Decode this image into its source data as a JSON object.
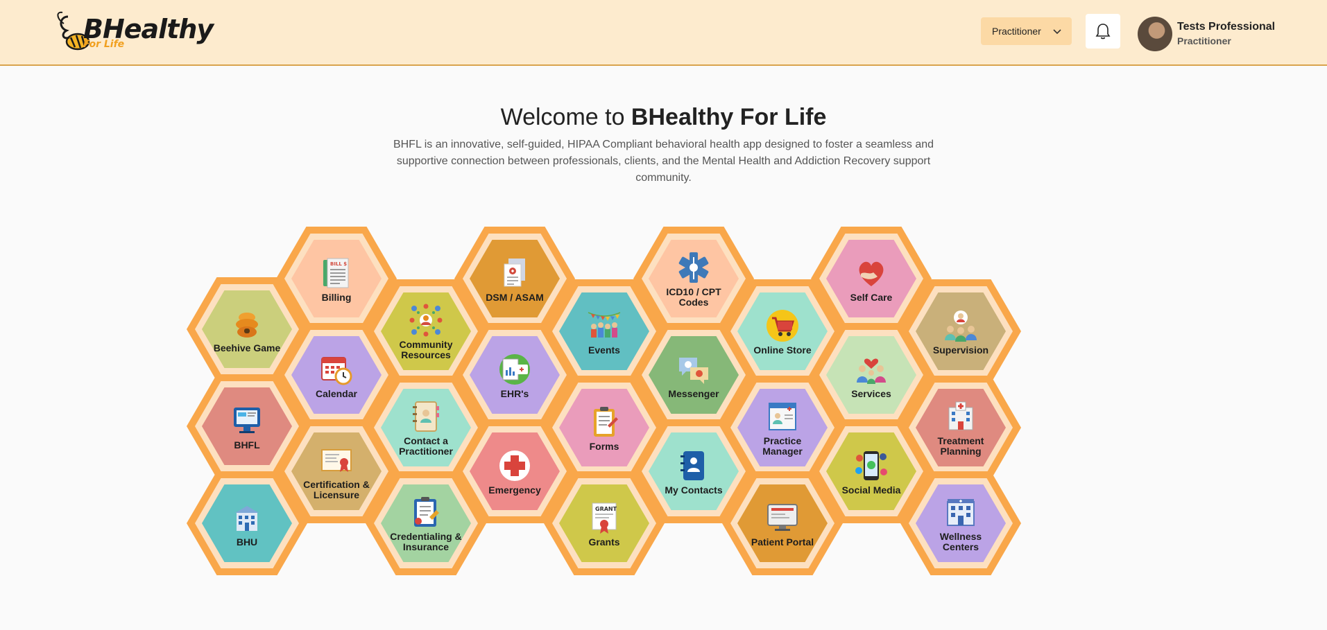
{
  "brand": {
    "main": "BHealthy",
    "sub": "For Life"
  },
  "header": {
    "role_selected": "Practitioner",
    "user_name": "Tests Professional",
    "user_role": "Practitioner"
  },
  "welcome": {
    "prefix": "Welcome to ",
    "name": "BHealthy For Life",
    "intro": "BHFL is an innovative, self-guided, HIPAA Compliant behavioral health app designed to foster a seamless and supportive connection between professionals, clients, and the Mental Health and Addiction Recovery support community."
  },
  "tiles": [
    {
      "label": "Beehive Game",
      "color": "#cbcf7c",
      "icon": "beehive-icon"
    },
    {
      "label": "BHFL",
      "color": "#df8a80",
      "icon": "computer-icon"
    },
    {
      "label": "BHU",
      "color": "#61c2c2",
      "icon": "building-icon"
    },
    {
      "label": "Billing",
      "color": "#fec5a3",
      "icon": "bill-icon"
    },
    {
      "label": "Calendar",
      "color": "#bba3e6",
      "icon": "calendar-icon"
    },
    {
      "label": "Certification & Licensure",
      "color": "#d4b06c",
      "icon": "certificate-icon"
    },
    {
      "label": "Community Resources",
      "color": "#cfc84a",
      "icon": "community-icon"
    },
    {
      "label": "Contact a Practitioner",
      "color": "#9ee1cd",
      "icon": "contact-book-icon"
    },
    {
      "label": "Credentialing & Insurance",
      "color": "#a3d3a1",
      "icon": "clipboard-icon"
    },
    {
      "label": "DSM / ASAM",
      "color": "#e09a35",
      "icon": "documents-icon"
    },
    {
      "label": "EHR's",
      "color": "#bba3e6",
      "icon": "ehr-icon"
    },
    {
      "label": "Emergency",
      "color": "#ee8a8a",
      "icon": "emergency-cross-icon"
    },
    {
      "label": "Events",
      "color": "#61bfc2",
      "icon": "event-crowd-icon"
    },
    {
      "label": "Forms",
      "color": "#ea9cbb",
      "icon": "form-icon"
    },
    {
      "label": "Grants",
      "color": "#cfc84a",
      "icon": "grant-certificate-icon"
    },
    {
      "label": "ICD10 / CPT Codes",
      "color": "#fec5a3",
      "icon": "medical-star-icon"
    },
    {
      "label": "Messenger",
      "color": "#86b878",
      "icon": "chat-bubbles-icon"
    },
    {
      "label": "My Contacts",
      "color": "#9ee1cd",
      "icon": "address-book-icon"
    },
    {
      "label": "Online Store",
      "color": "#9ee1cd",
      "icon": "shopping-cart-icon"
    },
    {
      "label": "Practice Manager",
      "color": "#bba3e6",
      "icon": "profile-card-icon"
    },
    {
      "label": "Patient Portal",
      "color": "#e09a35",
      "icon": "monitor-icon"
    },
    {
      "label": "Self Care",
      "color": "#ea9cbb",
      "icon": "heart-hands-icon"
    },
    {
      "label": "Services",
      "color": "#c6e3b6",
      "icon": "family-icon"
    },
    {
      "label": "Social Media",
      "color": "#cfc84a",
      "icon": "social-phone-icon"
    },
    {
      "label": "Supervision",
      "color": "#c9b07a",
      "icon": "supervisor-icon"
    },
    {
      "label": "Treatment Planning",
      "color": "#df8a80",
      "icon": "hospital-icon"
    },
    {
      "label": "Wellness Centers",
      "color": "#bba3e6",
      "icon": "wellness-building-icon"
    }
  ]
}
